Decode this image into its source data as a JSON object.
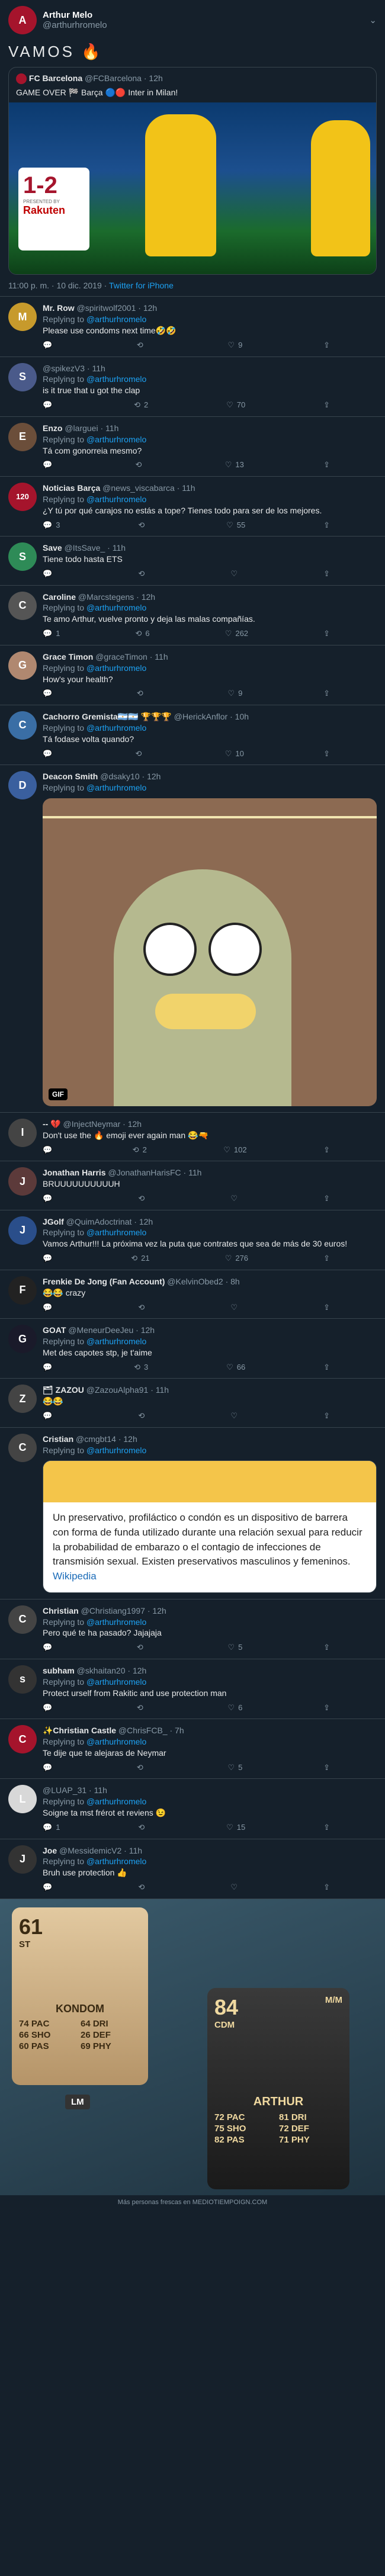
{
  "tweet": {
    "author_name": "Arthur Melo",
    "author_handle": "@arthurhromelo",
    "text": "VAMOS 🔥",
    "quote": {
      "author_name": "FC Barcelona",
      "author_handle": "@FCBarcelona",
      "time": "12h",
      "text": "GAME OVER 🏁 Barça 🔵🔴 Inter in Milan!",
      "score": "1-2",
      "sponsor_label": "PRESENTED BY",
      "sponsor": "Rakuten"
    },
    "timestamp": "11:00 p. m. · 10 dic. 2019",
    "source": "Twitter for iPhone"
  },
  "replies": [
    {
      "name": "Mr. Row",
      "handle": "@spiritwolf2001",
      "time": "12h",
      "replying": "Replying to",
      "to": "@arthurhromelo",
      "text": "Please use condoms next time🤣🤣",
      "r": "",
      "rt": "",
      "l": "9",
      "color": "#c79a2c",
      "initial": "M"
    },
    {
      "name": "",
      "handle": "@spikezV3",
      "time": "11h",
      "replying": "Replying to",
      "to": "@arthurhromelo",
      "text": "is it true that u got the clap",
      "r": "",
      "rt": "2",
      "l": "70",
      "color": "#4a5a8a",
      "initial": "S"
    },
    {
      "name": "Enzo",
      "handle": "@larguei",
      "time": "11h",
      "replying": "Replying to",
      "to": "@arthurhromelo",
      "text": "Tá com gonorreia mesmo?",
      "r": "",
      "rt": "",
      "l": "13",
      "color": "#6b4e3a",
      "initial": "E"
    },
    {
      "name": "Noticias Barça",
      "handle": "@news_viscabarca",
      "time": "11h",
      "replying": "Replying to",
      "to": "@arthurhromelo",
      "text": "¿Y tú por qué carajos no estás a tope? Tienes todo para ser de los mejores.",
      "r": "3",
      "rt": "",
      "l": "55",
      "color": "#a5142c",
      "initial": "120"
    },
    {
      "name": "Save",
      "handle": "@ItsSave_",
      "time": "11h",
      "replying": "",
      "to": "",
      "text": "Tiene todo hasta ETS",
      "r": "",
      "rt": "",
      "l": "",
      "color": "#2e8b57",
      "initial": "S"
    },
    {
      "name": "Caroline",
      "handle": "@Marcstegens",
      "time": "12h",
      "replying": "Replying to",
      "to": "@arthurhromelo",
      "text": "Te amo Arthur, vuelve pronto y deja las malas compañías.",
      "r": "1",
      "rt": "6",
      "l": "262",
      "color": "#555",
      "initial": "C"
    },
    {
      "name": "Grace Timon",
      "handle": "@graceTimon",
      "time": "11h",
      "replying": "Replying to",
      "to": "@arthurhromelo",
      "text": "How's your health?",
      "r": "",
      "rt": "",
      "l": "9",
      "color": "#b08870",
      "initial": "G"
    },
    {
      "name": "Cachorro Gremista🇦🇷🇦🇷 🏆🏆🏆",
      "handle": "@HerickAnflor",
      "time": "10h",
      "replying": "Replying to",
      "to": "@arthurhromelo",
      "text": "Tá fodase volta quando?",
      "r": "",
      "rt": "",
      "l": "10",
      "color": "#3a6ea5",
      "initial": "C"
    }
  ],
  "gif_reply": {
    "name": "Deacon Smith",
    "handle": "@dsaky10",
    "time": "12h",
    "replying": "Replying to",
    "to": "@arthurhromelo",
    "gif_label": "GIF",
    "color": "#3a5f9e",
    "initial": "D"
  },
  "replies2": [
    {
      "name": "-- 💔",
      "handle": "@InjectNeymar",
      "time": "12h",
      "replying": "",
      "to": "",
      "text": "Don't use the 🔥 emoji ever again man 😂🔫",
      "r": "",
      "rt": "2",
      "l": "102",
      "color": "#444",
      "initial": "I"
    },
    {
      "name": "Jonathan Harris",
      "handle": "@JonathanHarisFC",
      "time": "11h",
      "replying": "",
      "to": "",
      "text": "BRUUUUUUUUUUH",
      "r": "",
      "rt": "",
      "l": "",
      "color": "#5c3a3a",
      "initial": "J"
    },
    {
      "name": "JGolf",
      "handle": "@QuimAdoctrinat",
      "time": "12h",
      "replying": "Replying to",
      "to": "@arthurhromelo",
      "text": "Vamos Arthur!!! La próxima vez la puta que contrates que sea de más de 30 euros!",
      "r": "",
      "rt": "21",
      "l": "276",
      "color": "#2a4e8a",
      "initial": "J"
    },
    {
      "name": "Frenkie De Jong (Fan Account)",
      "handle": "@KelvinObed2",
      "time": "8h",
      "replying": "",
      "to": "",
      "text": "😂😂 crazy",
      "r": "",
      "rt": "",
      "l": "",
      "color": "#222",
      "initial": "F"
    },
    {
      "name": "GOAT",
      "handle": "@MeneurDeeJeu",
      "time": "12h",
      "replying": "Replying to",
      "to": "@arthurhromelo",
      "text": "Met des capotes stp, je t'aime",
      "r": "",
      "rt": "3",
      "l": "66",
      "color": "#1a1a2a",
      "initial": "G"
    },
    {
      "name": "🗂 ZAZOU",
      "handle": "@ZazouAlpha91",
      "time": "11h",
      "replying": "",
      "to": "",
      "text": "😂😂",
      "r": "",
      "rt": "",
      "l": "",
      "color": "#444",
      "initial": "Z"
    }
  ],
  "card_reply": {
    "name": "Cristian",
    "handle": "@cmgbt14",
    "time": "12h",
    "replying": "Replying to",
    "to": "@arthurhromelo",
    "card_text": "Un preservativo, profiláctico o condón es un dispositivo de barrera con forma de funda utilizado durante una relación sexual para reducir la probabilidad de embarazo o el contagio de infecciones de transmisión sexual. Existen preservativos masculinos y femeninos.",
    "card_link": "Wikipedia",
    "color": "#444",
    "initial": "C"
  },
  "replies3": [
    {
      "name": "Christian",
      "handle": "@Christiang1997",
      "time": "12h",
      "replying": "Replying to",
      "to": "@arthurhromelo",
      "text": "Pero qué te ha pasado? Jajajaja",
      "r": "",
      "rt": "",
      "l": "5",
      "color": "#444",
      "initial": "C"
    },
    {
      "name": "subham",
      "handle": "@skhaitan20",
      "time": "12h",
      "replying": "Replying to",
      "to": "@arthurhromelo",
      "text": "Protect urself from Rakitic and use protection man",
      "r": "",
      "rt": "",
      "l": "6",
      "color": "#333",
      "initial": "s"
    },
    {
      "name": "✨Christian Castle",
      "handle": "@ChrisFCB_",
      "time": "7h",
      "replying": "Replying to",
      "to": "@arthurhromelo",
      "text": "Te dije que te alejaras de Neymar",
      "r": "",
      "rt": "",
      "l": "5",
      "color": "#a5142c",
      "initial": "C"
    },
    {
      "name": "",
      "handle": "@LUAP_31",
      "time": "11h",
      "replying": "Replying to",
      "to": "@arthurhromelo",
      "text": "Soigne ta mst frérot et reviens 😉",
      "r": "1",
      "rt": "",
      "l": "15",
      "color": "#d8d8d8",
      "initial": "L"
    },
    {
      "name": "Joe",
      "handle": "@MessidemicV2",
      "time": "11h",
      "replying": "Replying to",
      "to": "@arthurhromelo",
      "text": "Bruh use protection 👍",
      "r": "",
      "rt": "",
      "l": "",
      "color": "#333",
      "initial": "J"
    }
  ],
  "fut": {
    "left": {
      "rating": "61",
      "position": "ST",
      "name": "KONDOM",
      "pac": "74 PAC",
      "sho": "66 SHO",
      "pas": "60 PAS",
      "dri": "64 DRI",
      "def": "26 DEF",
      "phy": "69 PHY",
      "badge": "LM"
    },
    "right": {
      "rating": "84",
      "position": "CDM",
      "tag": "M/M",
      "name": "ARTHUR",
      "pac": "72 PAC",
      "sho": "75 SHO",
      "pas": "82 PAS",
      "dri": "81 DRI",
      "def": "72 DEF",
      "phy": "71 PHY"
    }
  },
  "footer": "Más personas frescas en MEDIOTIEMPOIGN.COM"
}
